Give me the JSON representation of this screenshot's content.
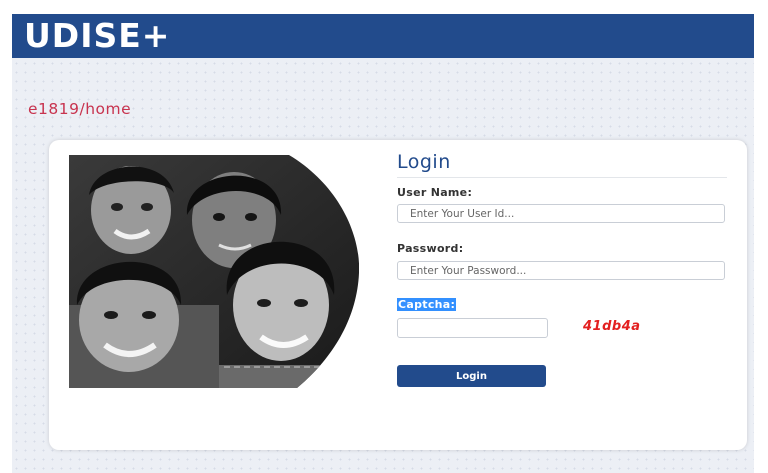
{
  "header": {
    "logo_text": "UDISE+"
  },
  "url_fragment": "e1819/home",
  "login": {
    "title": "Login",
    "username_label": "User Name:",
    "username_placeholder": "Enter Your User Id...",
    "password_label": "Password:",
    "password_placeholder": "Enter Your Password...",
    "captcha_label": "Captcha:",
    "captcha_value": "",
    "captcha_code": "41db4a",
    "submit_label": "Login"
  },
  "colors": {
    "brand_blue": "#224b8c",
    "captcha_red": "#e32020",
    "url_red": "#c8344f",
    "selection_blue": "#3390ff"
  }
}
